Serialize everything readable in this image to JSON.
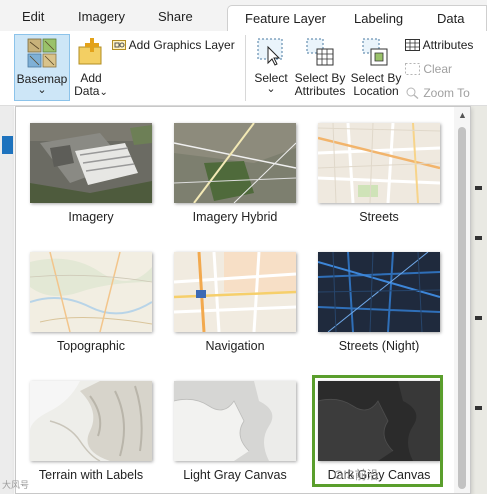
{
  "tabs": {
    "edit": "Edit",
    "imagery": "Imagery",
    "share": "Share",
    "feature_layer": "Feature Layer",
    "labeling": "Labeling",
    "data": "Data"
  },
  "ribbon": {
    "basemap_label": "Basemap",
    "basemap_arrow": "⌄",
    "add_data_line1": "Add",
    "add_data_line2": "Data",
    "add_data_arrow": "⌄",
    "add_graphics_layer": "Add Graphics Layer",
    "select_label": "Select",
    "select_arrow": "⌄",
    "select_by_attr_line1": "Select By",
    "select_by_attr_line2": "Attributes",
    "select_by_loc_line1": "Select By",
    "select_by_loc_line2": "Location",
    "attributes": "Attributes",
    "clear": "Clear",
    "zoom_to": "Zoom To"
  },
  "gallery": {
    "basemaps": [
      {
        "label": "Imagery"
      },
      {
        "label": "Imagery Hybrid"
      },
      {
        "label": "Streets"
      },
      {
        "label": "Topographic"
      },
      {
        "label": "Navigation"
      },
      {
        "label": "Streets (Night)"
      },
      {
        "label": "Terrain with Labels"
      },
      {
        "label": "Light Gray Canvas"
      },
      {
        "label": "Dark Gray Canvas"
      }
    ],
    "selected_index": 8,
    "selected_color": "#5a9e2c"
  },
  "watermark": "GIS前沿",
  "watermark_small": "大风号"
}
